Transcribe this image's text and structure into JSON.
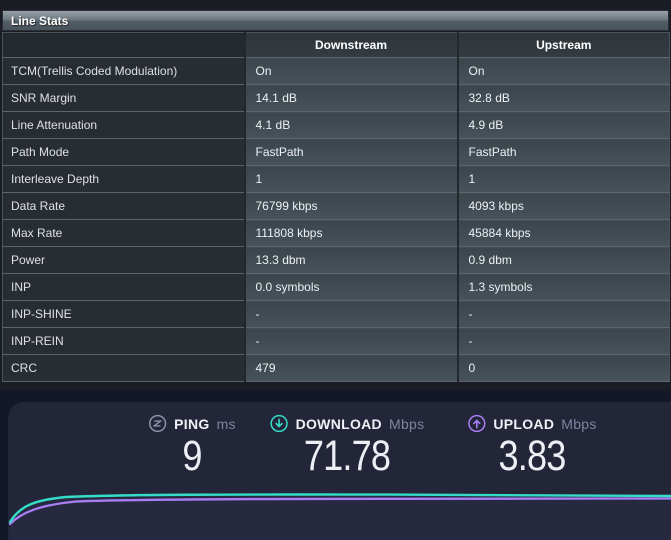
{
  "title_bar": {
    "title": "Line Stats"
  },
  "table": {
    "columns": [
      "Downstream",
      "Upstream"
    ],
    "rows": [
      {
        "label": "TCM(Trellis Coded Modulation)",
        "downstream": "On",
        "upstream": "On"
      },
      {
        "label": "SNR Margin",
        "downstream": "14.1 dB",
        "upstream": "32.8 dB"
      },
      {
        "label": "Line Attenuation",
        "downstream": "4.1 dB",
        "upstream": "4.9 dB"
      },
      {
        "label": "Path Mode",
        "downstream": "FastPath",
        "upstream": "FastPath"
      },
      {
        "label": "Interleave Depth",
        "downstream": "1",
        "upstream": "1"
      },
      {
        "label": "Data Rate",
        "downstream": "76799 kbps",
        "upstream": "4093 kbps"
      },
      {
        "label": "Max Rate",
        "downstream": "111808 kbps",
        "upstream": "45884 kbps"
      },
      {
        "label": "Power",
        "downstream": "13.3 dbm",
        "upstream": "0.9 dbm"
      },
      {
        "label": "INP",
        "downstream": "0.0 symbols",
        "upstream": "1.3 symbols"
      },
      {
        "label": "INP-SHINE",
        "downstream": "-",
        "upstream": "-"
      },
      {
        "label": "INP-REIN",
        "downstream": "-",
        "upstream": "-"
      },
      {
        "label": "CRC",
        "downstream": "479",
        "upstream": "0"
      }
    ]
  },
  "speedtest": {
    "metrics": [
      {
        "id": "ping",
        "label": "PING",
        "unit": "ms",
        "value": "9",
        "color": "#8b93a7"
      },
      {
        "id": "download",
        "label": "DOWNLOAD",
        "unit": "Mbps",
        "value": "71.78",
        "color": "#35dcc8"
      },
      {
        "id": "upload",
        "label": "UPLOAD",
        "unit": "Mbps",
        "value": "3.83",
        "color": "#a97ef2"
      }
    ],
    "graph": {
      "type": "line",
      "description": "transfer speed over test duration, fast rise then flat plateau",
      "series": [
        {
          "name": "download",
          "color": "#35dcc8"
        },
        {
          "name": "upload",
          "color": "#a97ef2"
        }
      ]
    }
  }
}
